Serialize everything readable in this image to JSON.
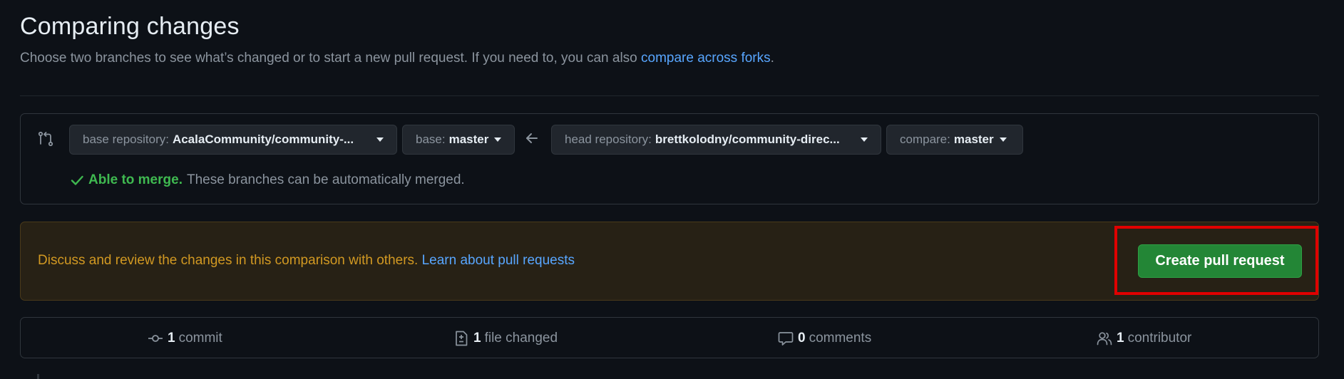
{
  "header": {
    "title": "Comparing changes",
    "subtitle_text": "Choose two branches to see what’s changed or to start a new pull request. If you need to, you can also ",
    "subtitle_link": "compare across forks",
    "subtitle_end": "."
  },
  "range": {
    "base_repo_label": "base repository:",
    "base_repo_value": "AcalaCommunity/community-...",
    "base_label": "base:",
    "base_value": "master",
    "head_repo_label": "head repository:",
    "head_repo_value": "brettkolodny/community-direc...",
    "compare_label": "compare:",
    "compare_value": "master"
  },
  "merge": {
    "status": "Able to merge.",
    "message": "These branches can be automatically merged."
  },
  "flash": {
    "text": "Discuss and review the changes in this comparison with others. ",
    "link": "Learn about pull requests",
    "button": "Create pull request"
  },
  "stats": {
    "commits_count": "1",
    "commits_label": "commit",
    "files_count": "1",
    "files_label": "file changed",
    "comments_count": "0",
    "comments_label": "comments",
    "contributors_count": "1",
    "contributors_label": "contributor"
  },
  "colors": {
    "background": "#0d1117",
    "link": "#58a6ff",
    "success": "#3fb950",
    "warning_text": "#d29922",
    "primary_button": "#238636",
    "highlight": "#e00000"
  },
  "icons": [
    "git-compare-icon",
    "chevron-down-icon",
    "arrow-left-icon",
    "check-icon",
    "git-commit-icon",
    "file-diff-icon",
    "comment-icon",
    "people-icon"
  ]
}
